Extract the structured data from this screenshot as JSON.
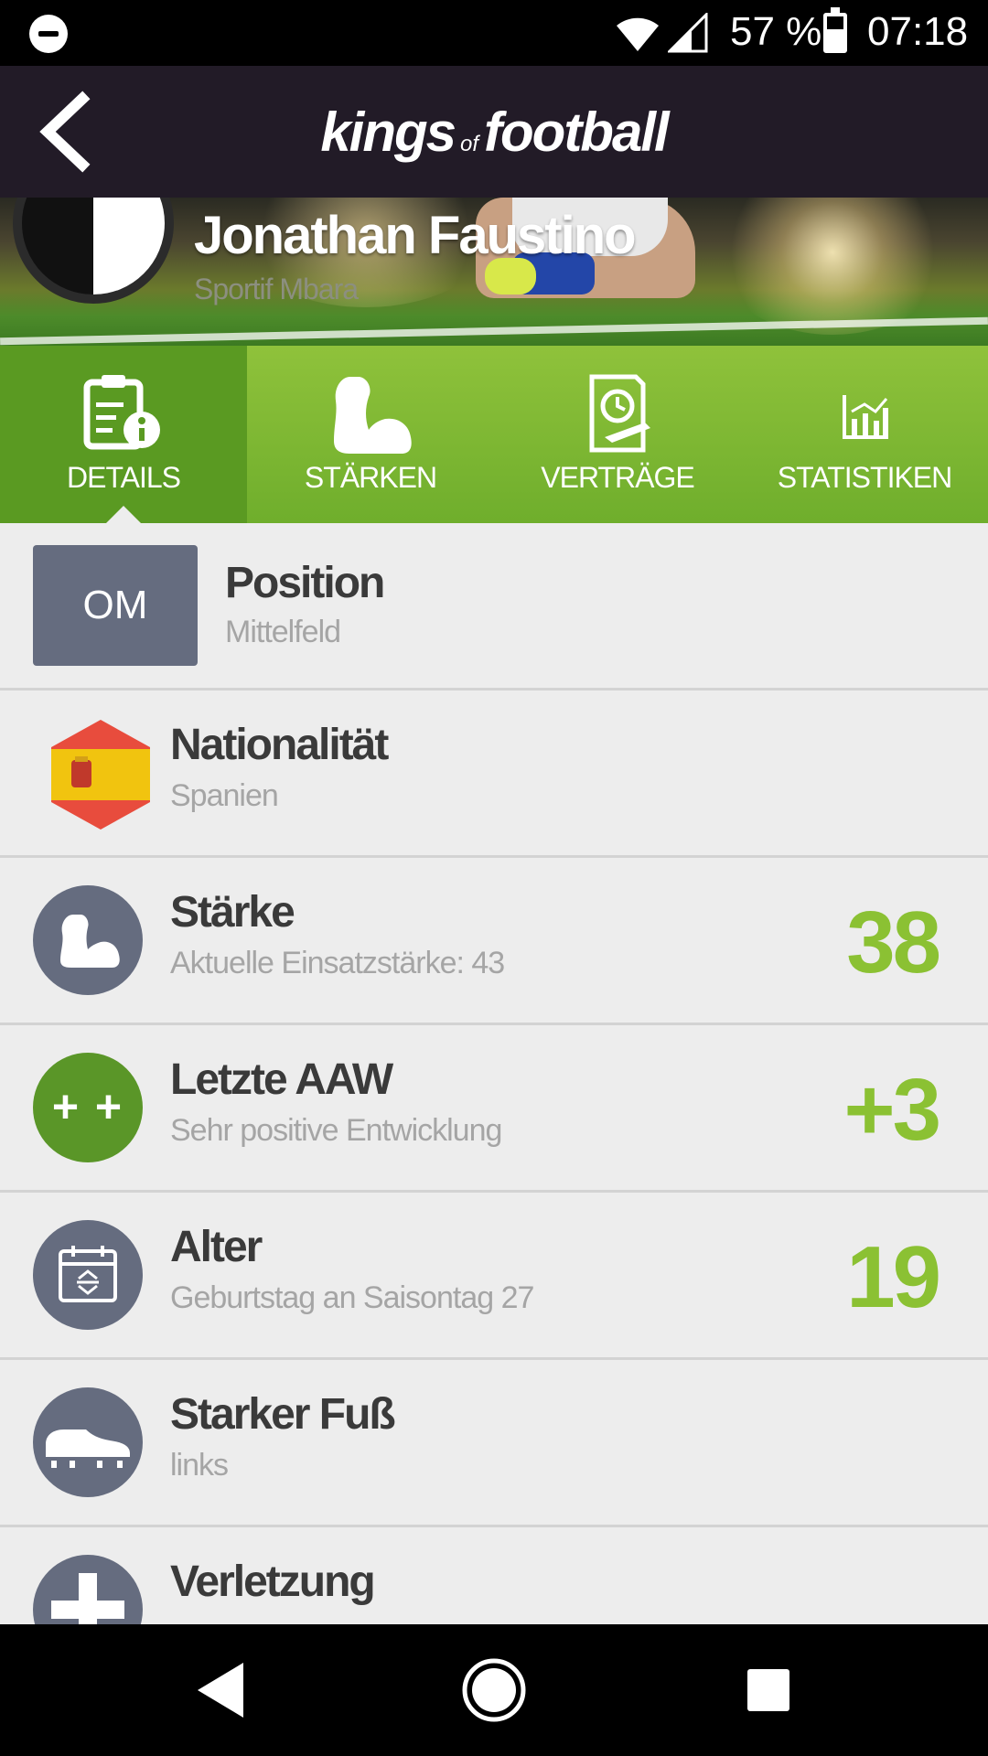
{
  "status_bar": {
    "battery_percent": "57 %",
    "time": "07:18",
    "icons": [
      "do-not-disturb-icon",
      "wifi-icon",
      "signal-icon",
      "battery-icon"
    ]
  },
  "header": {
    "logo_kings": "kings",
    "logo_of": "of",
    "logo_football": "football"
  },
  "player": {
    "name": "Jonathan Faustino",
    "club": "Sportif Mbara"
  },
  "tabs": [
    {
      "label": "DETAILS",
      "icon": "clipboard-info-icon",
      "active": true
    },
    {
      "label": "STÄRKEN",
      "icon": "flexed-arm-icon",
      "active": false
    },
    {
      "label": "VERTRÄGE",
      "icon": "contract-icon",
      "active": false
    },
    {
      "label": "STATISTIKEN",
      "icon": "bar-chart-icon",
      "active": false
    }
  ],
  "details": {
    "position": {
      "badge": "OM",
      "title": "Position",
      "subtitle": "Mittelfeld"
    },
    "nationality": {
      "title": "Nationalität",
      "subtitle": "Spanien",
      "flag_colors": [
        "#e84c3d",
        "#f1c40f"
      ]
    },
    "strength": {
      "title": "Stärke",
      "subtitle": "Aktuelle Einsatzstärke: 43",
      "value": "38"
    },
    "last_aaw": {
      "badge": "+ +",
      "title": "Letzte AAW",
      "subtitle": "Sehr positive Entwicklung",
      "value": "+3"
    },
    "age": {
      "title": "Alter",
      "subtitle": "Geburtstag an Saisontag 27",
      "value": "19"
    },
    "strong_foot": {
      "title": "Starker Fuß",
      "subtitle": "links"
    },
    "injury": {
      "title": "Verletzung"
    }
  },
  "colors": {
    "accent_green": "#8bc133",
    "tab_green": "#7ab530",
    "icon_gray": "#656c7f",
    "header_dark": "#221b27"
  }
}
